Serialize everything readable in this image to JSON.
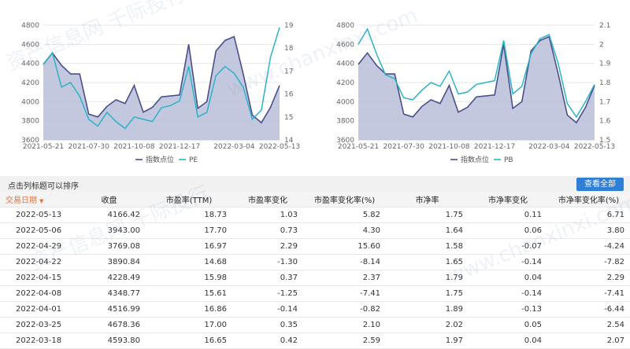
{
  "chart_data": [
    {
      "type": "area",
      "x": [
        "2021-05-21",
        "2021-06-04",
        "2021-06-18",
        "2021-07-02",
        "2021-07-16",
        "2021-07-30",
        "2021-08-13",
        "2021-08-27",
        "2021-09-10",
        "2021-09-24",
        "2021-10-08",
        "2021-10-22",
        "2021-11-05",
        "2021-11-19",
        "2021-12-03",
        "2021-12-17",
        "2021-12-31",
        "2022-01-14",
        "2022-01-28",
        "2022-02-11",
        "2022-02-25",
        "2022-03-04",
        "2022-03-18",
        "2022-04-01",
        "2022-04-15",
        "2022-04-29",
        "2022-05-13"
      ],
      "xticks": [
        "2021-05-21",
        "2021-07-30",
        "2021-10-08",
        "2021-12-17",
        "2022-03-04",
        "2022-05-13"
      ],
      "series": [
        {
          "name": "指数点位",
          "axis": "left",
          "type": "area",
          "values": [
            4390,
            4510,
            4380,
            4290,
            4290,
            3870,
            3840,
            3950,
            4020,
            3980,
            4170,
            3890,
            3940,
            4050,
            4060,
            4070,
            4600,
            3930,
            4000,
            4530,
            4640,
            4680,
            4290,
            3860,
            3780,
            3940,
            4170
          ]
        },
        {
          "name": "PE",
          "axis": "right",
          "type": "line",
          "values": [
            17.3,
            17.8,
            16.3,
            16.5,
            15.9,
            14.9,
            14.6,
            15.2,
            14.8,
            14.5,
            15.0,
            14.9,
            14.8,
            15.4,
            15.5,
            15.7,
            17.2,
            15.0,
            15.2,
            16.8,
            17.2,
            16.9,
            16.3,
            14.9,
            15.3,
            17.6,
            18.9
          ]
        }
      ],
      "yleft": {
        "ticks": [
          3600,
          3800,
          4000,
          4200,
          4400,
          4600,
          4800
        ],
        "ylim": [
          3600,
          4800
        ]
      },
      "yright": {
        "ticks": [
          14,
          15,
          16,
          17,
          18,
          19
        ],
        "ylim": [
          14,
          19
        ]
      },
      "grid": true,
      "legend_position": "bottom"
    },
    {
      "type": "area",
      "x": [
        "2021-05-21",
        "2021-06-04",
        "2021-06-18",
        "2021-07-02",
        "2021-07-16",
        "2021-07-30",
        "2021-08-13",
        "2021-08-27",
        "2021-09-10",
        "2021-09-24",
        "2021-10-08",
        "2021-10-22",
        "2021-11-05",
        "2021-11-19",
        "2021-12-03",
        "2021-12-17",
        "2021-12-31",
        "2022-01-14",
        "2022-01-28",
        "2022-02-11",
        "2022-02-25",
        "2022-03-04",
        "2022-03-18",
        "2022-04-01",
        "2022-04-15",
        "2022-04-29",
        "2022-05-13"
      ],
      "xticks": [
        "2021-05-21",
        "2021-07-30",
        "2021-10-08",
        "2021-12-17",
        "2022-03-04",
        "2022-05-13"
      ],
      "series": [
        {
          "name": "指数点位",
          "axis": "left",
          "type": "area",
          "values": [
            4390,
            4510,
            4380,
            4290,
            4290,
            3870,
            3840,
            3950,
            4020,
            3980,
            4170,
            3890,
            3940,
            4050,
            4060,
            4070,
            4600,
            3930,
            4000,
            4530,
            4640,
            4680,
            4290,
            3860,
            3780,
            3940,
            4170
          ]
        },
        {
          "name": "PB",
          "axis": "right",
          "type": "line",
          "values": [
            2.0,
            2.08,
            1.95,
            1.84,
            1.82,
            1.72,
            1.71,
            1.76,
            1.8,
            1.78,
            1.86,
            1.74,
            1.75,
            1.79,
            1.8,
            1.81,
            2.02,
            1.74,
            1.78,
            1.95,
            2.03,
            2.05,
            1.9,
            1.69,
            1.62,
            1.7,
            1.79
          ]
        }
      ],
      "yleft": {
        "ticks": [
          3600,
          3800,
          4000,
          4200,
          4400,
          4600,
          4800
        ],
        "ylim": [
          3600,
          4800
        ]
      },
      "yright": {
        "ticks": [
          1.5,
          1.6,
          1.7,
          1.8,
          1.9,
          2,
          2.1
        ],
        "ylim": [
          1.5,
          2.1
        ]
      },
      "grid": true,
      "legend_position": "bottom"
    }
  ],
  "colors": {
    "index_fill": "#b9bed9",
    "index_line": "#4a4e8a",
    "ratio_line": "#2bb3c6",
    "accent": "#e8723a",
    "button": "#2f7fd6"
  },
  "watermarks": [
    "资产信息网 千际投行",
    "www.chanxinxi.com",
    "资产信息网 千际投行",
    "www.chanxinxi.com"
  ],
  "sort_hint": "点击列标题可以排序",
  "view_all_label": "查看全部",
  "table": {
    "headers": [
      "交易日期",
      "收盘",
      "市盈率(TTM)",
      "市盈率变化",
      "市盈率变化率(%)",
      "市净率",
      "市净率变化",
      "市净率变化率(%)"
    ],
    "rows": [
      [
        "2022-05-13",
        "4166.42",
        "18.73",
        "1.03",
        "5.82",
        "1.75",
        "0.11",
        "6.71"
      ],
      [
        "2022-05-06",
        "3943.00",
        "17.70",
        "0.73",
        "4.30",
        "1.64",
        "0.06",
        "3.80"
      ],
      [
        "2022-04-29",
        "3769.08",
        "16.97",
        "2.29",
        "15.60",
        "1.58",
        "-0.07",
        "-4.24"
      ],
      [
        "2022-04-22",
        "3890.84",
        "14.68",
        "-1.30",
        "-8.14",
        "1.65",
        "-0.14",
        "-7.82"
      ],
      [
        "2022-04-15",
        "4228.49",
        "15.98",
        "0.37",
        "2.37",
        "1.79",
        "0.04",
        "2.29"
      ],
      [
        "2022-04-08",
        "4348.77",
        "15.61",
        "-1.25",
        "-7.41",
        "1.75",
        "-0.14",
        "-7.41"
      ],
      [
        "2022-04-01",
        "4516.99",
        "16.86",
        "-0.14",
        "-0.82",
        "1.89",
        "-0.13",
        "-6.44"
      ],
      [
        "2022-03-25",
        "4678.36",
        "17.00",
        "0.35",
        "2.10",
        "2.02",
        "0.05",
        "2.54"
      ],
      [
        "2022-03-18",
        "4593.80",
        "16.65",
        "0.42",
        "2.59",
        "1.97",
        "0.04",
        "2.07"
      ]
    ]
  }
}
